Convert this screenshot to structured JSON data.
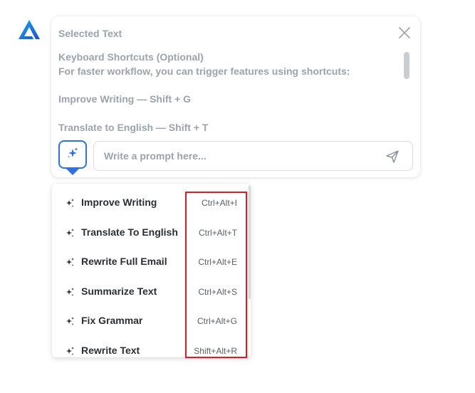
{
  "app": {
    "logo_icon": "app-logo-icon",
    "accent_color": "#2f6fe8"
  },
  "panel": {
    "title": "Selected Text",
    "close_icon": "close-icon",
    "content_lines": [
      "Keyboard Shortcuts (Optional)",
      "For faster workflow, you can trigger features using shortcuts:",
      "",
      "Improve Writing — Shift + G",
      "",
      "Translate to English — Shift + T"
    ],
    "ai_button_icon": "sparkle-icon",
    "prompt_placeholder": "Write a prompt here...",
    "prompt_value": "",
    "send_icon": "send-icon"
  },
  "dropdown": {
    "items": [
      {
        "label": "Improve Writing",
        "shortcut": "Ctrl+Alt+I",
        "icon": "sparkle-icon"
      },
      {
        "label": "Translate To English",
        "shortcut": "Ctrl+Alt+T",
        "icon": "sparkle-icon"
      },
      {
        "label": "Rewrite Full Email",
        "shortcut": "Ctrl+Alt+E",
        "icon": "sparkle-icon"
      },
      {
        "label": "Summarize Text",
        "shortcut": "Ctrl+Alt+S",
        "icon": "sparkle-icon"
      },
      {
        "label": "Fix Grammar",
        "shortcut": "Ctrl+Alt+G",
        "icon": "sparkle-icon"
      },
      {
        "label": "Rewrite Text",
        "shortcut": "Shift+Alt+R",
        "icon": "sparkle-icon"
      }
    ]
  },
  "annotation": {
    "highlight_color": "#e01b24"
  }
}
